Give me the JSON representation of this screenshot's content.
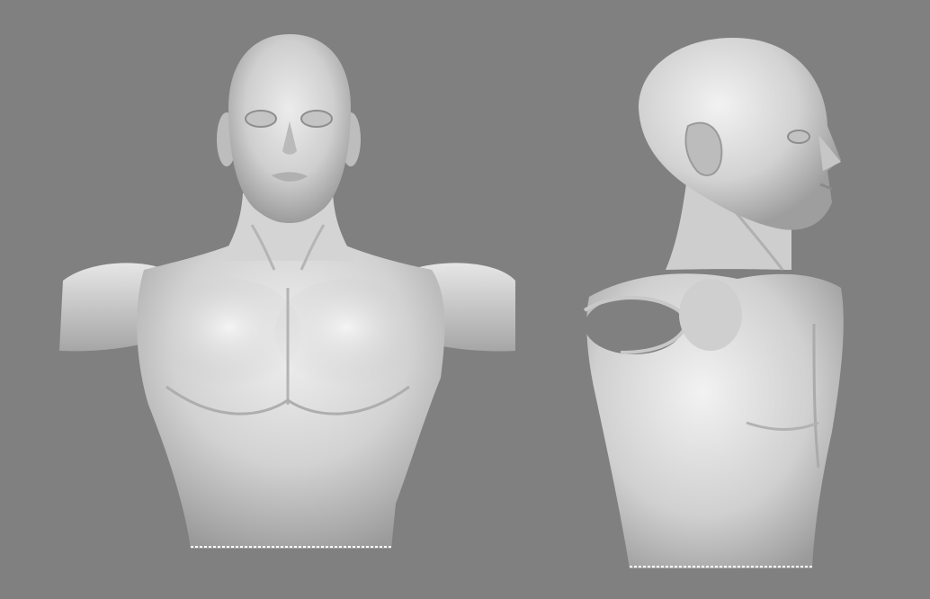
{
  "scene": {
    "background_color": "#808080",
    "surface_color": "#d6d6d6",
    "highlight_color": "#f2f2f2",
    "shadow_color": "#6e6e6e"
  },
  "models": [
    {
      "view": "front"
    },
    {
      "view": "three-quarter-side"
    }
  ]
}
